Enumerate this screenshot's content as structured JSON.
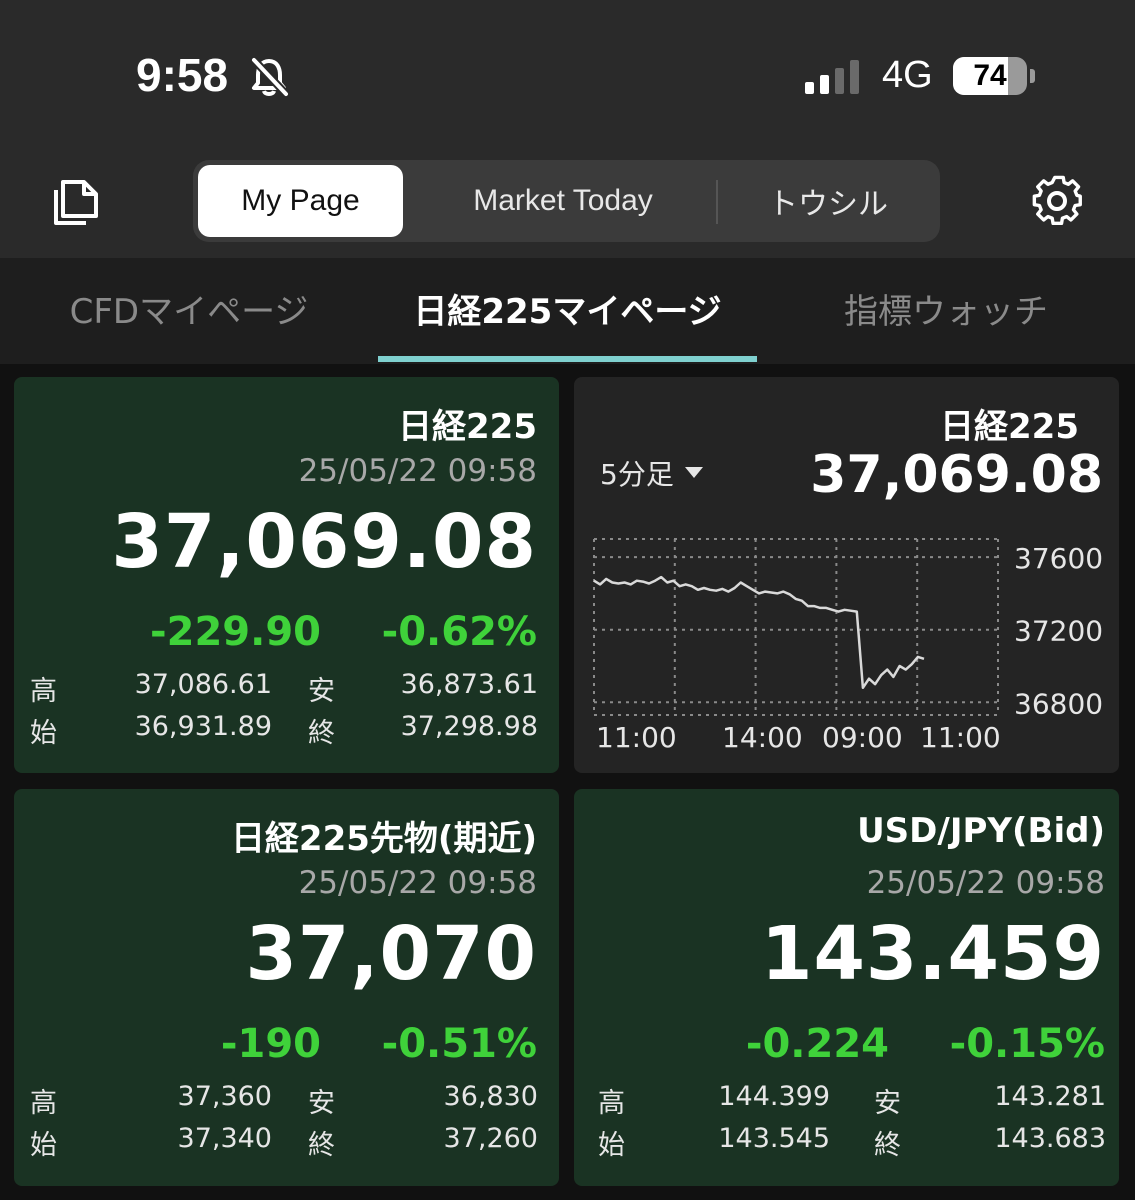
{
  "status_bar": {
    "time": "9:58",
    "network": "4G",
    "battery": "74",
    "battery_level": 0.74
  },
  "top_nav": {
    "segments": [
      {
        "label": "My Page",
        "active": true
      },
      {
        "label": "Market Today",
        "active": false
      },
      {
        "label": "トウシル",
        "active": false
      }
    ]
  },
  "sub_tabs": [
    {
      "label": "CFDマイページ",
      "active": false
    },
    {
      "label": "日経225マイページ",
      "active": true
    },
    {
      "label": "指標ウォッチ",
      "active": false
    }
  ],
  "cards": {
    "nikkei": {
      "title": "日経225",
      "time": "25/05/22 09:58",
      "price": "37,069.08",
      "change": "-229.90",
      "change_pct": "-0.62%",
      "high_label": "高",
      "high": "37,086.61",
      "low_label": "安",
      "low": "36,873.61",
      "open_label": "始",
      "open": "36,931.89",
      "close_label": "終",
      "close": "37,298.98"
    },
    "futures": {
      "title": "日経225先物(期近)",
      "time": "25/05/22 09:58",
      "price": "37,070",
      "change": "-190",
      "change_pct": "-0.51%",
      "high_label": "高",
      "high": "37,360",
      "low_label": "安",
      "low": "36,830",
      "open_label": "始",
      "open": "37,340",
      "close_label": "終",
      "close": "37,260"
    },
    "usdjpy": {
      "title": "USD/JPY(Bid)",
      "time": "25/05/22 09:58",
      "price": "143.459",
      "change": "-0.224",
      "change_pct": "-0.15%",
      "high_label": "高",
      "high": "144.399",
      "low_label": "安",
      "low": "143.281",
      "open_label": "始",
      "open": "143.545",
      "close_label": "終",
      "close": "143.683"
    }
  },
  "chart_card": {
    "title": "日経225",
    "timeframe": "5分足",
    "price": "37,069.08"
  },
  "chart_data": {
    "type": "line",
    "x_ticks": [
      "11:00",
      "14:00",
      "09:00",
      "11:00"
    ],
    "y_ticks": [
      37600,
      37200,
      36800
    ],
    "ylim": [
      36730,
      37700
    ],
    "grid": true,
    "color": "#d9d9d9",
    "values": [
      37470,
      37450,
      37480,
      37460,
      37455,
      37460,
      37450,
      37470,
      37465,
      37455,
      37470,
      37490,
      37460,
      37470,
      37440,
      37450,
      37440,
      37420,
      37430,
      37420,
      37415,
      37425,
      37410,
      37430,
      37460,
      37440,
      37420,
      37400,
      37410,
      37405,
      37400,
      37410,
      37395,
      37370,
      37360,
      37330,
      37330,
      37320,
      37320,
      37310,
      37300,
      37310,
      37305,
      37300,
      36880,
      36930,
      36900,
      36950,
      36980,
      36940,
      37000,
      36980,
      37010,
      37050,
      37040
    ]
  },
  "colors": {
    "green_card": "#1a3323",
    "dark_card": "#242424",
    "change_green": "#3fd23a",
    "tab_underline": "#7fd0cf"
  }
}
